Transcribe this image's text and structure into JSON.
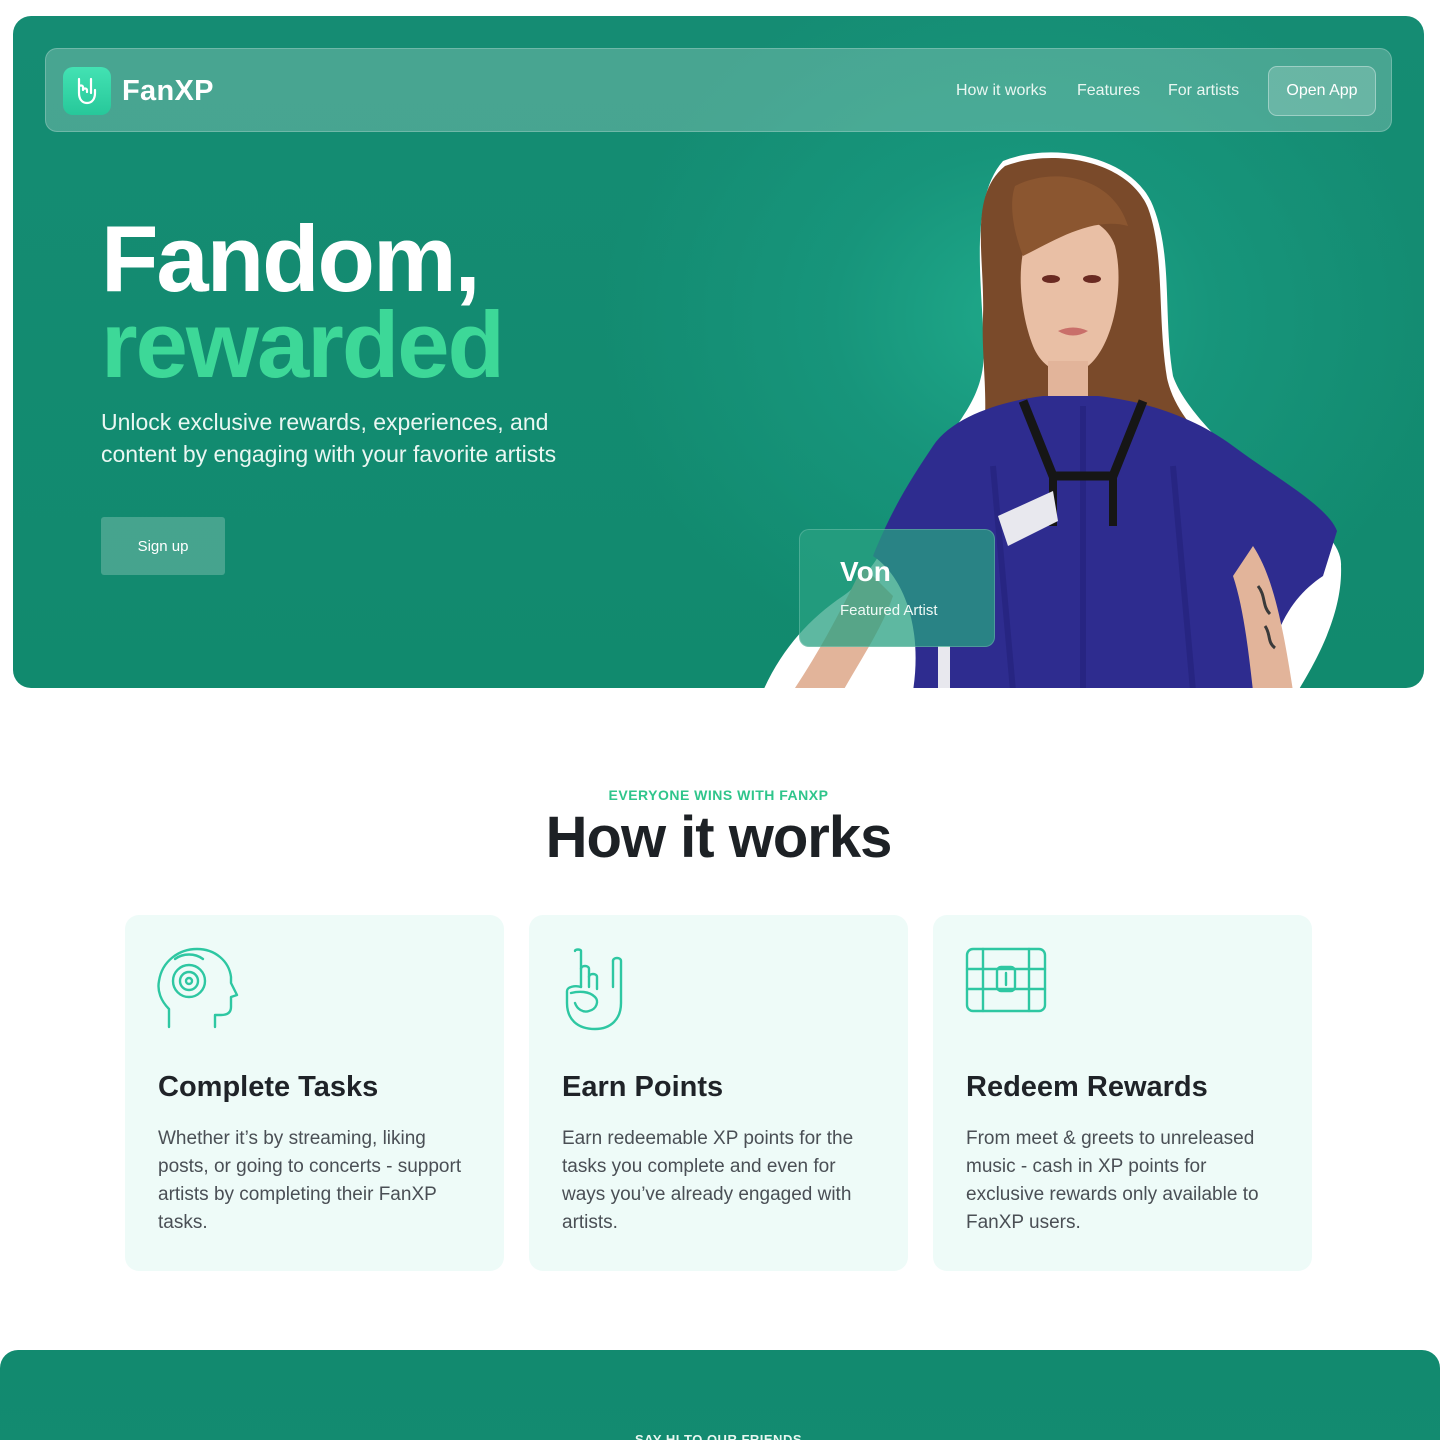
{
  "nav": {
    "brand": "FanXP",
    "links": [
      "How it works",
      "Features",
      "For artists"
    ],
    "cta": "Open App"
  },
  "hero": {
    "title_line1": "Fandom,",
    "title_line2": "rewarded",
    "subtitle": "Unlock exclusive rewards, experiences, and content by engaging with your favorite artists",
    "signup": "Sign up",
    "artist": {
      "name": "Von",
      "role": "Featured Artist"
    }
  },
  "how": {
    "eyebrow": "EVERYONE WINS WITH FANXP",
    "title": "How it works",
    "cards": [
      {
        "icon": "headphones-head-icon",
        "title": "Complete Tasks",
        "text": "Whether it’s by streaming, liking posts, or going to concerts - support artists by completing their FanXP tasks."
      },
      {
        "icon": "rock-hand-icon",
        "title": "Earn Points",
        "text": "Earn redeemable XP points for the tasks you complete and even for ways you’ve already engaged with artists."
      },
      {
        "icon": "treasure-chest-icon",
        "title": "Redeem Rewards",
        "text": "From meet & greets to unreleased music - cash in XP points for exclusive rewards only available to FanXP users."
      }
    ]
  },
  "band": {
    "label": "SAY HI TO OUR FRIENDS"
  },
  "colors": {
    "brand_green": "#158c73",
    "accent_green": "#3dd898",
    "card_bg": "#eefbf8"
  }
}
